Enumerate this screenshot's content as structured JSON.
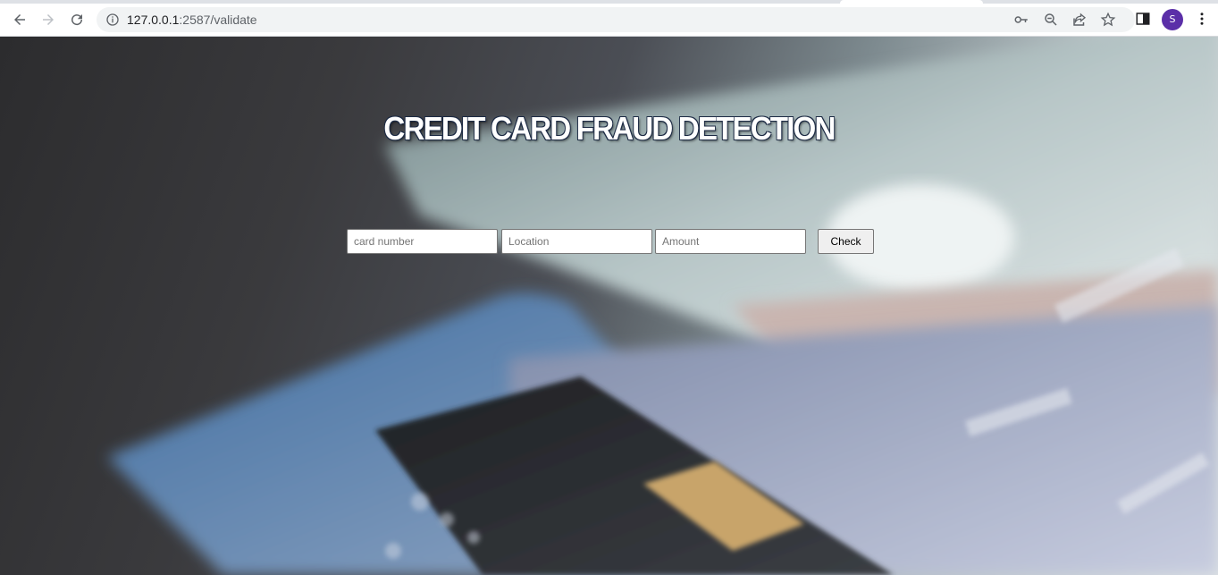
{
  "browser": {
    "url_host": "127.0.0.1",
    "url_rest": ":2587/validate",
    "profile_initial": "S",
    "icons": [
      "back-icon",
      "forward-icon",
      "reload-icon",
      "info-icon",
      "key-icon",
      "zoom-icon",
      "share-icon",
      "star-icon",
      "side-panel-icon",
      "menu-icon"
    ]
  },
  "page": {
    "title": "CREDIT CARD FRAUD DETECTION",
    "form": {
      "card_placeholder": "card number",
      "location_placeholder": "Location",
      "amount_placeholder": "Amount",
      "card_value": "",
      "location_value": "",
      "amount_value": "",
      "submit_label": "Check"
    }
  },
  "colors": {
    "avatar": "#5b2fa8",
    "omnibox": "#f1f3f4",
    "title_text": "#ffffff"
  }
}
